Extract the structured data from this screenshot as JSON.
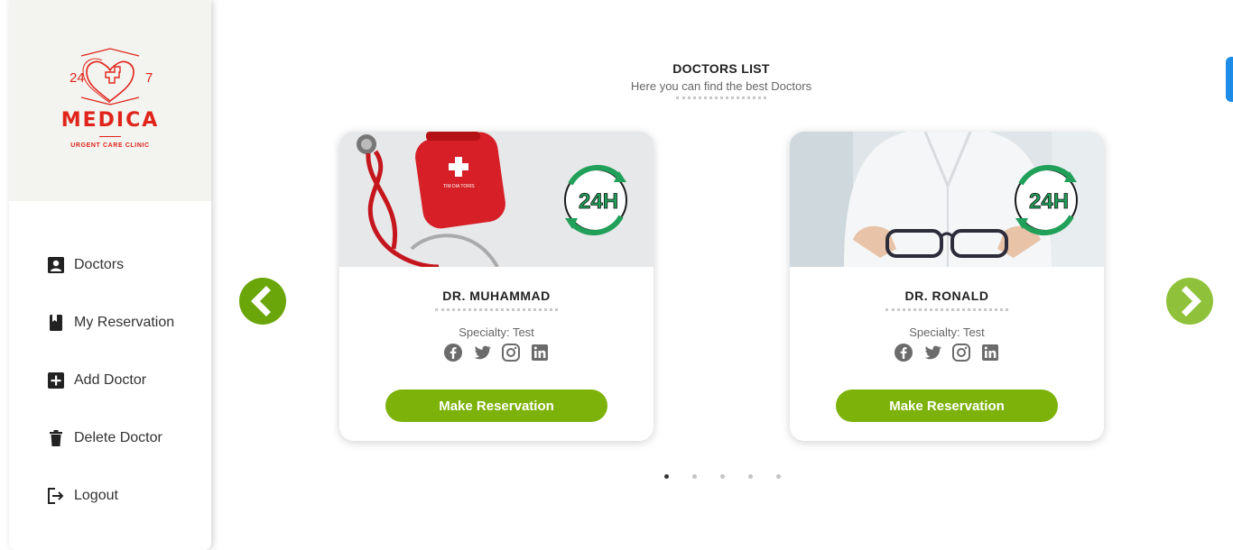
{
  "brand": {
    "numbers_left": "24",
    "numbers_right": "7",
    "name": "MEDICA",
    "tagline": "URGENT CARE CLINIC"
  },
  "nav": {
    "items": [
      {
        "label": "Doctors",
        "icon": "person-card-icon"
      },
      {
        "label": "My Reservation",
        "icon": "bookmark-book-icon"
      },
      {
        "label": "Add Doctor",
        "icon": "plus-box-icon"
      },
      {
        "label": "Delete Doctor",
        "icon": "trash-icon"
      },
      {
        "label": "Logout",
        "icon": "logout-icon"
      }
    ]
  },
  "page": {
    "title": "DOCTORS LIST",
    "subtitle": "Here you can find the best Doctors"
  },
  "cards": [
    {
      "name": "DR. MUHAMMAD",
      "specialty": "Specialty: Test",
      "button": "Make Reservation",
      "badge": "24H",
      "kit_text": "TIM DIA TORIS"
    },
    {
      "name": "DR. RONALD",
      "specialty": "Specialty: Test",
      "button": "Make Reservation",
      "badge": "24H"
    }
  ],
  "pager": {
    "count": 5,
    "active": 1
  },
  "colors": {
    "accent": "#7cb20a",
    "brand_red": "#e0241b",
    "arrow_left": "#6aa609",
    "arrow_right": "#8fc23a",
    "edge_tab": "#1c8ce8"
  }
}
